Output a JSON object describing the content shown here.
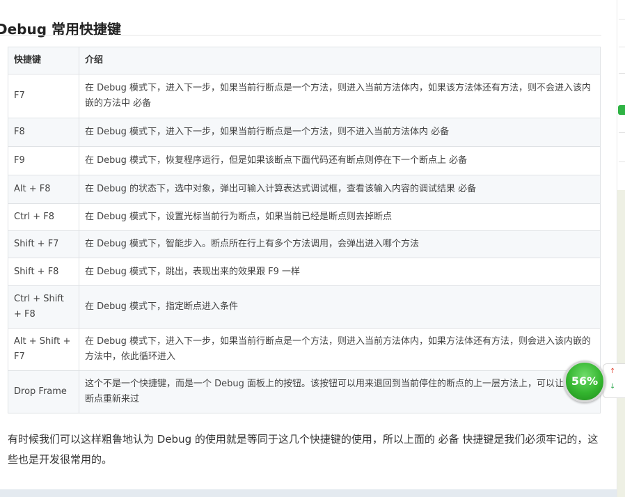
{
  "heading": "Debug 常用快捷键",
  "table": {
    "headers": [
      "快捷键",
      "介绍"
    ],
    "rows": [
      {
        "key": "F7",
        "desc": "在 Debug 模式下，进入下一步，如果当前行断点是一个方法，则进入当前方法体内，如果该方法体还有方法，则不会进入该内嵌的方法中 必备"
      },
      {
        "key": "F8",
        "desc": "在 Debug 模式下，进入下一步，如果当前行断点是一个方法，则不进入当前方法体内 必备"
      },
      {
        "key": "F9",
        "desc": "在 Debug 模式下，恢复程序运行，但是如果该断点下面代码还有断点则停在下一个断点上 必备"
      },
      {
        "key": "Alt + F8",
        "desc": "在 Debug 的状态下，选中对象，弹出可输入计算表达式调试框，查看该输入内容的调试结果 必备"
      },
      {
        "key": "Ctrl + F8",
        "desc": "在 Debug 模式下，设置光标当前行为断点，如果当前已经是断点则去掉断点"
      },
      {
        "key": "Shift + F7",
        "desc": "在 Debug 模式下，智能步入。断点所在行上有多个方法调用，会弹出进入哪个方法"
      },
      {
        "key": "Shift + F8",
        "desc": "在 Debug 模式下，跳出，表现出来的效果跟 F9 一样"
      },
      {
        "key": "Ctrl + Shift + F8",
        "desc": "在 Debug 模式下，指定断点进入条件"
      },
      {
        "key": "Alt + Shift + F7",
        "desc": "在 Debug 模式下，进入下一步，如果当前行断点是一个方法，则进入当前方法体内，如果方法体还有方法，则会进入该内嵌的方法中，依此循环进入"
      },
      {
        "key": "Drop Frame",
        "desc": "这个不是一个快捷键，而是一个 Debug 面板上的按钮。该按钮可以用来退回到当前停住的断点的上一层方法上，可以让过掉的断点重新来过"
      }
    ]
  },
  "paragraph": "有时候我们可以这样粗鲁地认为 Debug 的使用就是等同于这几个快捷键的使用，所以上面的 必备 快捷键是我们必须牢记的，这些也是开发很常用的。",
  "speed_widget": {
    "percent_label": "56%",
    "up_icon": "arrow-up-icon",
    "down_icon": "arrow-down-icon",
    "color": "#34b52f"
  }
}
